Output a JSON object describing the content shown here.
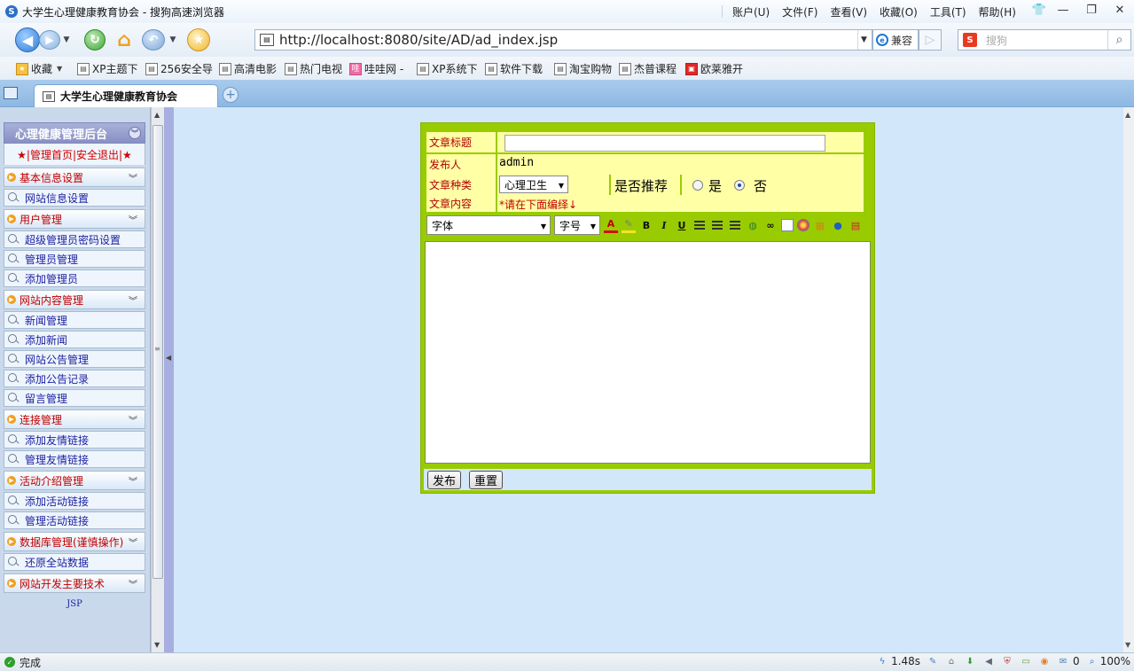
{
  "window": {
    "title": "大学生心理健康教育协会 - 搜狗高速浏览器",
    "menus": [
      "账户(U)",
      "文件(F)",
      "查看(V)",
      "收藏(O)",
      "工具(T)",
      "帮助(H)"
    ]
  },
  "navbar": {
    "url": "http://localhost:8080/site/AD/ad_index.jsp",
    "compat_label": "兼容",
    "search_placeholder": "搜狗"
  },
  "bookmarks": [
    "收藏",
    "XP主题下",
    "256安全导",
    "高清电影",
    "热门电视",
    "哇哇网 -",
    "XP系统下",
    "软件下载",
    "淘宝购物",
    "杰普课程",
    "欧莱雅开"
  ],
  "tab": {
    "label": "大学生心理健康教育协会"
  },
  "sidebar": {
    "title": "心理健康管理后台",
    "top_links": "★|管理首页|安全退出|★",
    "sections": [
      {
        "label": "基本信息设置",
        "items": [
          "网站信息设置"
        ]
      },
      {
        "label": "用户管理",
        "items": [
          "超级管理员密码设置",
          "管理员管理",
          "添加管理员"
        ]
      },
      {
        "label": "网站内容管理",
        "items": [
          "新闻管理",
          "添加新闻",
          "网站公告管理",
          "添加公告记录",
          "留言管理"
        ]
      },
      {
        "label": "连接管理",
        "items": [
          "添加友情链接",
          "管理友情链接"
        ]
      },
      {
        "label": "活动介绍管理",
        "items": [
          "添加活动链接",
          "管理活动链接"
        ]
      },
      {
        "label": "数据库管理(谨慎操作)",
        "items": [
          "还原全站数据"
        ]
      },
      {
        "label": "网站开发主要技术",
        "items": []
      }
    ],
    "tech_text": "JSP"
  },
  "form": {
    "title_label": "文章标题",
    "title_value": "",
    "author_label": "发布人",
    "author_value": "admin",
    "category_label": "文章种类",
    "category_value": "心理卫生",
    "recommend_label": "是否推荐",
    "recommend_yes": "是",
    "recommend_no": "否",
    "recommend_selected": "否",
    "content_label": "文章内容",
    "content_hint": "*请在下面编绎↓",
    "font_select": "字体",
    "size_select": "字号",
    "publish_button": "发布",
    "reset_button": "重置"
  },
  "status": {
    "text": "完成",
    "speed": "1.48s",
    "count": "0",
    "zoom": "100%"
  },
  "colors": {
    "form_border": "#99cc00",
    "form_row": "#ffffa6",
    "page_bg": "#d3e7fb",
    "label_red": "#b00000"
  }
}
